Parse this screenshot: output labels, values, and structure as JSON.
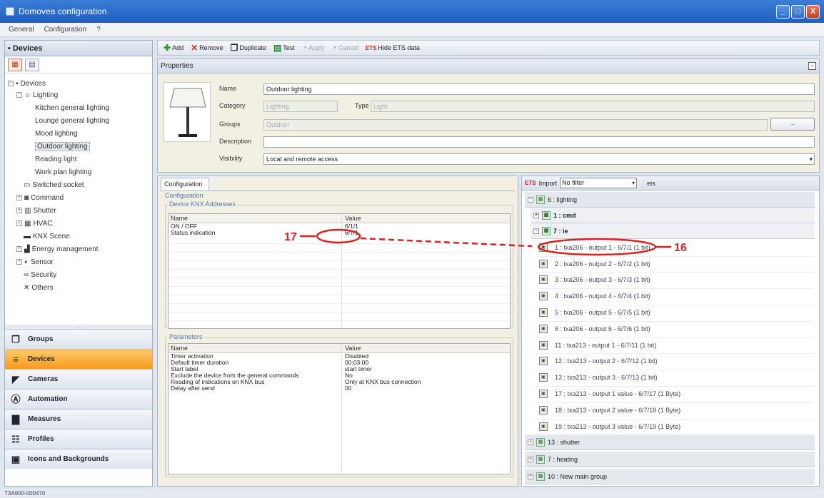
{
  "window": {
    "title": "Domovea configuration",
    "minimize": "_",
    "maximize": "□",
    "close": "X"
  },
  "menu": [
    "General",
    "Configuration",
    "?"
  ],
  "left": {
    "header": "Devices",
    "tree": {
      "root": "Devices",
      "lighting": "Lighting",
      "lights": [
        "Kitchen general lighting",
        "Lounge general lighting",
        "Mood lighting",
        "Outdoor lighting",
        "Reading light",
        "Work plan lighting"
      ],
      "others": [
        "Switched socket",
        "Command",
        "Shutter",
        "HVAC",
        "KNX Scene",
        "Energy management",
        "Sensor",
        "Security",
        "Others"
      ]
    },
    "splitter": ".....",
    "nav": [
      "Groups",
      "Devices",
      "Cameras",
      "Automation",
      "Measures",
      "Profiles",
      "Icons and Backgrounds"
    ]
  },
  "toolbar": {
    "add": "Add",
    "remove": "Remove",
    "duplicate": "Duplicate",
    "test": "Test",
    "apply": "Apply",
    "cancel": "Cancel",
    "hide_ets": "Hide ETS data",
    "ets_glyph": "ETS"
  },
  "properties": {
    "header": "Properties",
    "name_label": "Name",
    "name_value": "Outdoor lighting",
    "category_label": "Category",
    "category_value": "Lighting",
    "type_label": "Type",
    "type_value": "Light",
    "groups_label": "Groups",
    "groups_value": "Outdoor",
    "dots": "...",
    "description_label": "Description",
    "description_value": "",
    "visibility_label": "Visibility",
    "visibility_value": "Local and remote access"
  },
  "config": {
    "tab": "Configuration",
    "section": "Configuration",
    "knx_legend": "Device KNX Addresses",
    "col_name": "Name",
    "col_value": "Value",
    "addresses": [
      {
        "name": "ON / OFF",
        "value": "6/1/1"
      },
      {
        "name": "Status indication",
        "value": "6/7/1"
      }
    ],
    "params_legend": "Parameters",
    "params": [
      {
        "name": "Timer activation",
        "value": "Disabled"
      },
      {
        "name": "Default timer duration",
        "value": "00:03:00"
      },
      {
        "name": "Start label",
        "value": "start timer"
      },
      {
        "name": "Exclude the device from the general commands",
        "value": "No"
      },
      {
        "name": "Reading of indications on KNX bus",
        "value": "Only at KNX bus connection"
      },
      {
        "name": "Delay after send",
        "value": "00"
      }
    ]
  },
  "ets": {
    "import": "Import",
    "filter": "No filter",
    "eis": "eis",
    "groups": [
      {
        "label": "6 : lighting",
        "sign": "-"
      },
      {
        "label": "1 : cmd",
        "sign": "+"
      },
      {
        "label": "7 : ie",
        "sign": "-"
      }
    ],
    "addresses": [
      "1 : txa206 - output 1 - 6/7/1 (1 bit)",
      "2 : txa206 - output 2 - 6/7/2 (1 bit)",
      "3 : txa206 - output 3 - 6/7/3 (1 bit)",
      "4 : txa206 - output 4 - 6/7/4 (1 bit)",
      "5 : txa206 - output 5 - 6/7/5 (1 bit)",
      "6 : txa206 - output 6 - 6/7/6 (1 bit)",
      "11 : txa213 - output 1 - 6/7/11 (1 bit)",
      "12 : txa213 - output 2 - 6/7/12 (1 bit)",
      "13 : txa213 - output 3 - 6/7/13 (1 bit)",
      "17 : txa213 - output 1 value - 6/7/17 (1 Byte)",
      "18 : txa213 - output 2 value - 6/7/18 (1 Byte)",
      "19 : txa213 - output 3 value - 6/7/19 (1 Byte)"
    ],
    "bottom_groups": [
      "13 : shutter",
      "7 : heating",
      "10 : New main group"
    ]
  },
  "annotations": {
    "left": "17",
    "right": "16",
    "color": "#e02020"
  },
  "status": "T3A900-000470"
}
